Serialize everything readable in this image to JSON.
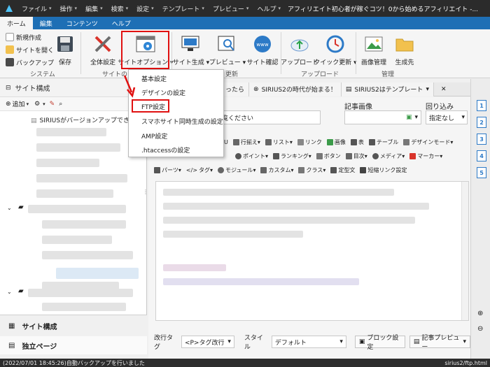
{
  "titlebar": {
    "menus": [
      "ファイル",
      "操作",
      "編集",
      "検索",
      "設定",
      "テンプレート",
      "プレビュー",
      "ヘルプ"
    ],
    "window_title": "アフィリエイト初心者が稼ぐコツ！0から始めるアフィリエイト -..."
  },
  "ribbon_tabs": [
    "ホーム",
    "編集",
    "コンテンツ",
    "ヘルプ"
  ],
  "ribbon": {
    "small_buttons": [
      "新規作成",
      "サイトを開く",
      "バックアップ"
    ],
    "save": "保存",
    "group_system": "システム",
    "group_site": "サイトの",
    "group_update": "更新",
    "group_upload": "アップロード",
    "group_manage": "管理",
    "overall_settings": "全体設定",
    "site_option": "サイトオプション",
    "site_generate": "サイト生成",
    "preview": "プレビュー",
    "site_check": "サイト確認",
    "upload": "アップロード",
    "quick_update": "クイック更新",
    "image_manage": "画像管理",
    "generated_dest": "生成先"
  },
  "left_panel": {
    "title": "サイト構成",
    "add_label": "追加",
    "first_item": "SIRIUSがバージョンアップできま",
    "bottom_items": [
      "サイト構成",
      "独立ページ"
    ]
  },
  "doc_tabs": [
    "ったら",
    "SIRIUS2の時代が始まる！",
    "SIRIUS2はテンプレート"
  ],
  "editor": {
    "title_hint": "覧ください",
    "article_image_label": "記事画像",
    "fold_label": "回り込み",
    "fold_value": "指定なし",
    "toolbar1": [
      "行揃え",
      "リスト",
      "リンク",
      "画像",
      "表",
      "テーブル",
      "デザインモード"
    ],
    "toolbar2": [
      "ポイント",
      "ランキング",
      "ボタン",
      "目次",
      "メディア",
      "マーカー"
    ],
    "toolbar3": [
      "パーツ",
      "タグ",
      "モジュール",
      "カスタム",
      "クラス",
      "定型文",
      "短縮リンク設定"
    ],
    "newline_label": "改行タグ",
    "newline_value": "<P>タグ改行",
    "style_label": "スタイル",
    "style_value": "デフォルト",
    "block_settings": "ブロック設定",
    "article_preview": "記事プレビュー"
  },
  "right_strip_numbers": [
    "1",
    "2",
    "3",
    "4",
    "5"
  ],
  "dropdown": {
    "items": [
      "基本設定",
      "デザインの設定",
      "FTP設定",
      "スマホサイト同時生成の設定",
      "AMP設定",
      ".htaccessの設定"
    ]
  },
  "status": {
    "left": "(2022/07/01 18:45:26)自動バックアップを行いました",
    "right": "sirius2/ftp.html"
  },
  "colors": {
    "accent_blue": "#1e6fb5",
    "highlight_red": "#e01010"
  }
}
